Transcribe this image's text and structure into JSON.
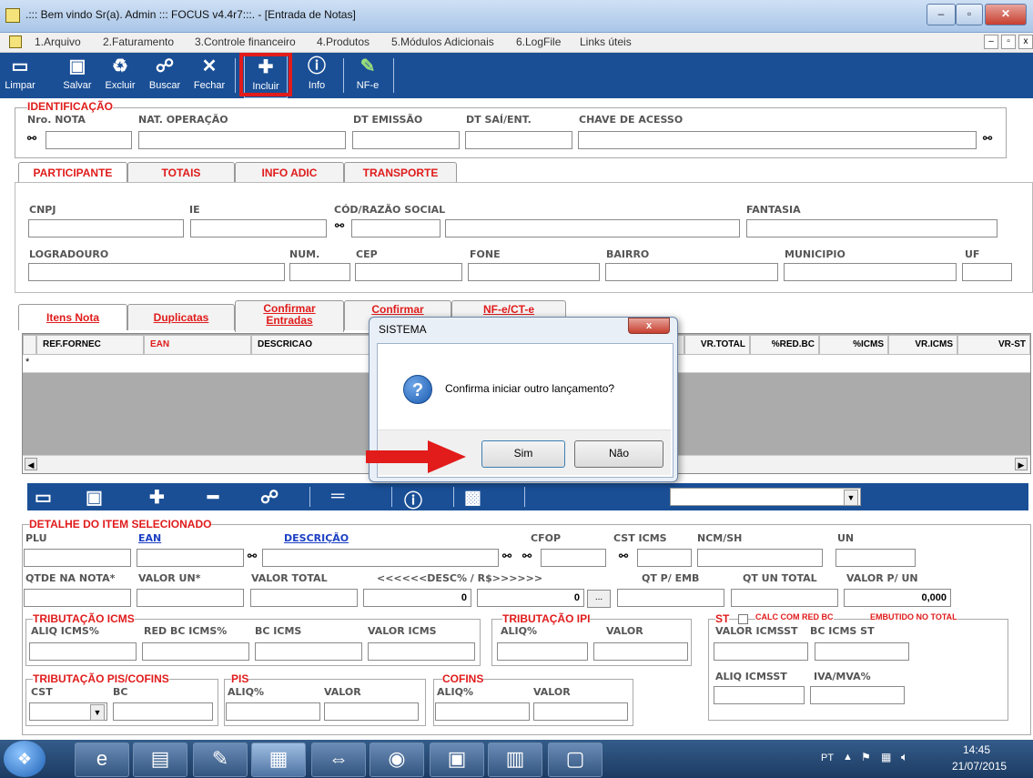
{
  "window": {
    "title": ".::: Bem vindo Sr(a). Admin ::: FOCUS v4.4r7:::.  - [Entrada de Notas]"
  },
  "menu": [
    "1.Arquivo",
    "2.Faturamento",
    "3.Controle financeiro",
    "4.Produtos",
    "5.Módulos Adicionais",
    "6.LogFile",
    "Links úteis"
  ],
  "toolbar": {
    "limpar": "Limpar",
    "salvar": "Salvar",
    "excluir": "Excluir",
    "buscar": "Buscar",
    "fechar": "Fechar",
    "incluir": "Incluir",
    "info": "Info",
    "nfe": "NF-e"
  },
  "identificacao": {
    "section": "IDENTIFICAÇÃO",
    "nro_nota": "Nro. NOTA",
    "nat_operacao": "NAT. OPERAÇÃO",
    "dt_emissao": "DT EMISSÃO",
    "dt_sai_ent": "DT SAÍ/ENT.",
    "chave_acesso": "CHAVE DE ACESSO"
  },
  "tabs_top": [
    "PARTICIPANTE",
    "TOTAIS",
    "INFO ADIC",
    "TRANSPORTE"
  ],
  "participante": {
    "cnpj": "CNPJ",
    "ie": "IE",
    "cod_razao": "CÓD/RAZÃO SOCIAL",
    "fantasia": "FANTASIA",
    "logradouro": "LOGRADOURO",
    "num": "NUM.",
    "cep": "CEP",
    "fone": "FONE",
    "bairro": "BAIRRO",
    "municipio": "MUNICIPIO",
    "uf": "UF"
  },
  "tabs_items": [
    "Itens Nota",
    "Duplicatas",
    "Confirmar Entradas",
    "Confirmar",
    "NF-e/CT-e"
  ],
  "grid": {
    "columns": [
      "REF.FORNEC",
      "EAN",
      "DESCRICAO",
      "VR.TOTAL",
      "%RED.BC",
      "%ICMS",
      "VR.ICMS",
      "VR-ST"
    ],
    "row_marker": "*"
  },
  "detalhe": {
    "section": "DETALHE DO ITEM SELECIONADO",
    "plu": "PLU",
    "ean": "EAN",
    "descricao": "DESCRIÇÃO",
    "cfop": "CFOP",
    "cst_icms": "CST ICMS",
    "ncm_sh": "NCM/SH",
    "un": "UN",
    "qtde_nota": "QTDE NA NOTA*",
    "valor_un": "VALOR UN*",
    "valor_total": "VALOR TOTAL",
    "desc": "<<<<<<DESC% / R$>>>>>>",
    "qt_emb": "QT P/ EMB",
    "qt_un_total": "QT UN TOTAL",
    "valor_p_un": "VALOR P/ UN",
    "desc_pct_value": "0",
    "desc_rs_value": "0",
    "valor_p_un_value": "0,000",
    "ellipsis": "..."
  },
  "trib_icms": {
    "section": "TRIBUTAÇÃO ICMS",
    "aliq": "ALIQ ICMS%",
    "red_bc": "RED BC ICMS%",
    "bc": "BC ICMS",
    "valor": "VALOR ICMS"
  },
  "trib_ipi": {
    "section": "TRIBUTAÇÃO IPI",
    "aliq": "ALIQ%",
    "valor": "VALOR"
  },
  "st": {
    "section": "ST",
    "calc_red_bc": "CALC COM RED BC",
    "embutido": "EMBUTIDO NO TOTAL",
    "valor_icmsst": "VALOR ICMSST",
    "bc_icms_st": "BC ICMS ST",
    "aliq_icmsst": "ALIQ ICMSST",
    "iva_mva": "IVA/MVA%"
  },
  "pis_cofins": {
    "section": "TRIBUTAÇÃO PIS/COFINS",
    "cst": "CST",
    "bc": "BC"
  },
  "pis": {
    "section": "PIS",
    "aliq": "ALIQ%",
    "valor": "VALOR"
  },
  "cofins": {
    "section": "COFINS",
    "aliq": "ALIQ%",
    "valor": "VALOR"
  },
  "dialog": {
    "title": "SISTEMA",
    "message": "Confirma iniciar outro lançamento?",
    "yes": "Sim",
    "no": "Não",
    "close": "x"
  },
  "taskbar": {
    "lang": "PT",
    "time": "14:45",
    "date": "21/07/2015"
  },
  "colors": {
    "toolbar_bg": "#1a4f96",
    "label_red": "#e01b1b",
    "highlight": "#e21b1b"
  }
}
